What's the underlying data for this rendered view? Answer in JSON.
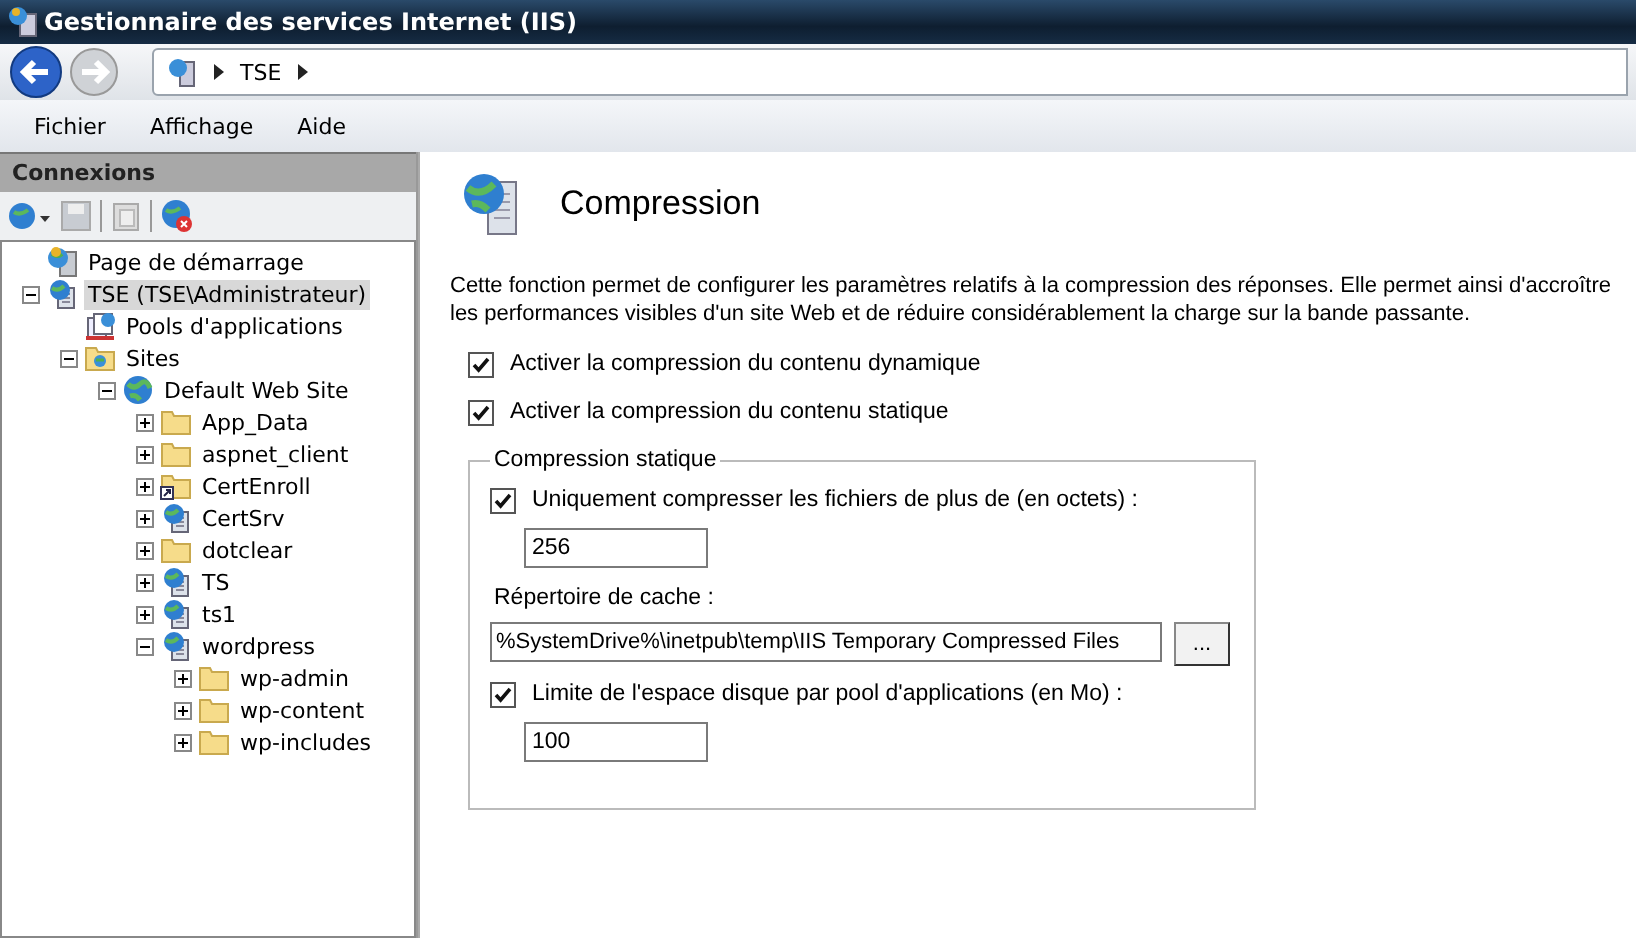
{
  "window": {
    "title": "Gestionnaire des services Internet (IIS)"
  },
  "address_bar": {
    "crumbs": [
      "TSE"
    ]
  },
  "menu": [
    "Fichier",
    "Affichage",
    "Aide"
  ],
  "connections": {
    "title": "Connexions",
    "tree": [
      {
        "label": "Page de démarrage",
        "kind": "start",
        "selected": false
      },
      {
        "label": "TSE (TSE\\Administrateur)",
        "kind": "server",
        "selected": true,
        "expanded": true,
        "children": [
          {
            "label": "Pools d'applications",
            "kind": "pools",
            "selected": false
          },
          {
            "label": "Sites",
            "kind": "sites",
            "selected": false,
            "expanded": true,
            "children": [
              {
                "label": "Default Web Site",
                "kind": "globe",
                "selected": false,
                "expanded": true,
                "children": [
                  {
                    "label": "App_Data",
                    "kind": "folder",
                    "selected": false,
                    "expanded": false
                  },
                  {
                    "label": "aspnet_client",
                    "kind": "folder",
                    "selected": false,
                    "expanded": false
                  },
                  {
                    "label": "CertEnroll",
                    "kind": "shortcut",
                    "selected": false,
                    "expanded": false
                  },
                  {
                    "label": "CertSrv",
                    "kind": "app",
                    "selected": false,
                    "expanded": false
                  },
                  {
                    "label": "dotclear",
                    "kind": "folder",
                    "selected": false,
                    "expanded": false
                  },
                  {
                    "label": "TS",
                    "kind": "app",
                    "selected": false,
                    "expanded": false
                  },
                  {
                    "label": "ts1",
                    "kind": "app",
                    "selected": false,
                    "expanded": false
                  },
                  {
                    "label": "wordpress",
                    "kind": "app",
                    "selected": false,
                    "expanded": true,
                    "children": [
                      {
                        "label": "wp-admin",
                        "kind": "folder",
                        "selected": false,
                        "expanded": false
                      },
                      {
                        "label": "wp-content",
                        "kind": "folder",
                        "selected": false,
                        "expanded": false
                      },
                      {
                        "label": "wp-includes",
                        "kind": "folder",
                        "selected": false,
                        "expanded": false
                      }
                    ]
                  }
                ]
              }
            ]
          }
        ]
      }
    ]
  },
  "page": {
    "title": "Compression",
    "description": "Cette fonction permet de configurer les paramètres relatifs à la compression des réponses. Elle permet ainsi d'accroître les performances visibles d'un site Web et de réduire considérablement la charge sur la bande passante.",
    "options": [
      {
        "label": "Activer la compression du contenu dynamique",
        "checked": true
      },
      {
        "label": "Activer la compression du contenu statique",
        "checked": true
      }
    ],
    "static_group": {
      "title": "Compression statique",
      "min_size": {
        "label": "Uniquement compresser les fichiers de plus de (en octets) :",
        "checked": true,
        "value": "256"
      },
      "cache_dir": {
        "label": "Répertoire de cache :",
        "value": "%SystemDrive%\\inetpub\\temp\\IIS Temporary Compressed Files",
        "browse": "..."
      },
      "disk_limit": {
        "label": "Limite de l'espace disque par pool d'applications (en Mo) :",
        "checked": true,
        "value": "100"
      }
    }
  }
}
